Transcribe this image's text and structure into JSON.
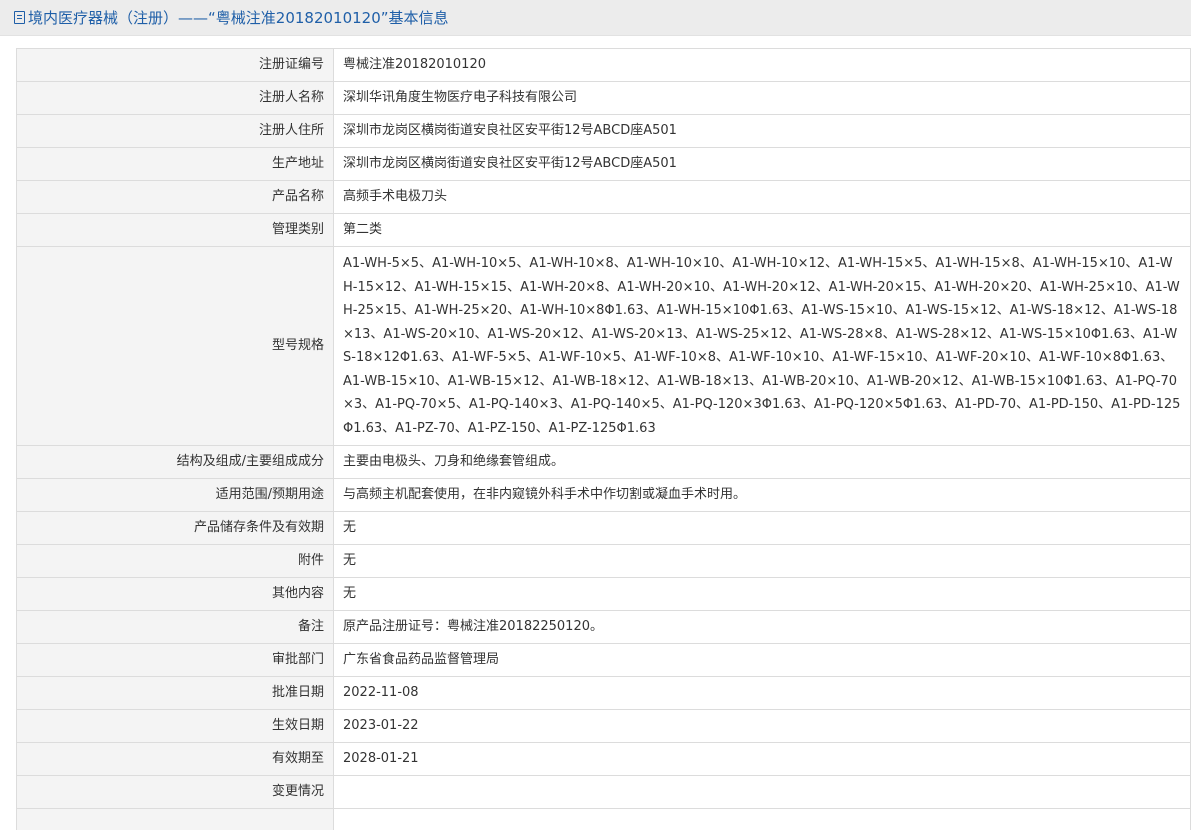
{
  "header": {
    "title": "境内医疗器械（注册）——“粤械注准20182010120”基本信息"
  },
  "rows": [
    {
      "label": "注册证编号",
      "value": "粤械注准20182010120"
    },
    {
      "label": "注册人名称",
      "value": "深圳华讯角度生物医疗电子科技有限公司"
    },
    {
      "label": "注册人住所",
      "value": "深圳市龙岗区横岗街道安良社区安平街12号ABCD座A501"
    },
    {
      "label": "生产地址",
      "value": "深圳市龙岗区横岗街道安良社区安平街12号ABCD座A501"
    },
    {
      "label": "产品名称",
      "value": "高频手术电极刀头"
    },
    {
      "label": "管理类别",
      "value": "第二类"
    },
    {
      "label": "型号规格",
      "value": "A1-WH-5×5、A1-WH-10×5、A1-WH-10×8、A1-WH-10×10、A1-WH-10×12、A1-WH-15×5、A1-WH-15×8、A1-WH-15×10、A1-WH-15×12、A1-WH-15×15、A1-WH-20×8、A1-WH-20×10、A1-WH-20×12、A1-WH-20×15、A1-WH-20×20、A1-WH-25×10、A1-WH-25×15、A1-WH-25×20、A1-WH-10×8Φ1.63、A1-WH-15×10Φ1.63、A1-WS-15×10、A1-WS-15×12、A1-WS-18×12、A1-WS-18×13、A1-WS-20×10、A1-WS-20×12、A1-WS-20×13、A1-WS-25×12、A1-WS-28×8、A1-WS-28×12、A1-WS-15×10Φ1.63、A1-WS-18×12Φ1.63、A1-WF-5×5、A1-WF-10×5、A1-WF-10×8、A1-WF-10×10、A1-WF-15×10、A1-WF-20×10、A1-WF-10×8Φ1.63、A1-WB-15×10、A1-WB-15×12、A1-WB-18×12、A1-WB-18×13、A1-WB-20×10、A1-WB-20×12、A1-WB-15×10Φ1.63、A1-PQ-70×3、A1-PQ-70×5、A1-PQ-140×3、A1-PQ-140×5、A1-PQ-120×3Φ1.63、A1-PQ-120×5Φ1.63、A1-PD-70、A1-PD-150、A1-PD-125Φ1.63、A1-PZ-70、A1-PZ-150、A1-PZ-125Φ1.63"
    },
    {
      "label": "结构及组成/主要组成成分",
      "value": "主要由电极头、刀身和绝缘套管组成。"
    },
    {
      "label": "适用范围/预期用途",
      "value": "与高频主机配套使用，在非内窥镜外科手术中作切割或凝血手术时用。"
    },
    {
      "label": "产品储存条件及有效期",
      "value": "无"
    },
    {
      "label": "附件",
      "value": "无"
    },
    {
      "label": "其他内容",
      "value": "无"
    },
    {
      "label": "备注",
      "value": "原产品注册证号：粤械注准20182250120。"
    },
    {
      "label": "审批部门",
      "value": "广东省食品药品监督管理局"
    },
    {
      "label": "批准日期",
      "value": "2022-11-08"
    },
    {
      "label": "生效日期",
      "value": "2023-01-22"
    },
    {
      "label": "有效期至",
      "value": "2028-01-21"
    },
    {
      "label": "变更情况",
      "value": ""
    },
    {
      "label": "",
      "value": ""
    }
  ]
}
